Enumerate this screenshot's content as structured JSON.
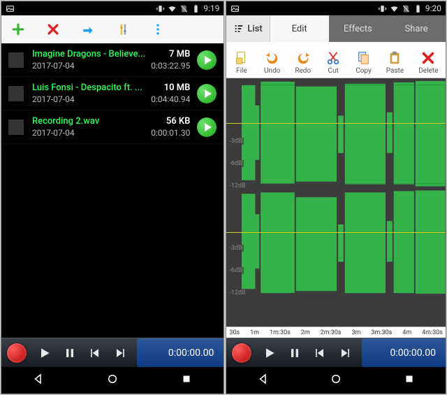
{
  "left": {
    "status": {
      "time": "9:19"
    },
    "files": [
      {
        "title": "Imagine Dragons - Believe...",
        "date": "2017-07-04",
        "size": "7 MB",
        "duration": "0:03:22.95"
      },
      {
        "title": "Luis Fonsi - Despacito ft. ...",
        "date": "2017-07-04",
        "size": "10 MB",
        "duration": "0:04:40.94"
      },
      {
        "title": "Recording 2.wav",
        "date": "2017-07-04",
        "size": "56 KB",
        "duration": "0:00:01.30"
      }
    ],
    "transport_time": "0:00:00.00"
  },
  "right": {
    "status": {
      "time": "9:20"
    },
    "list_button": "List",
    "tabs": {
      "edit": "Edit",
      "effects": "Effects",
      "share": "Share"
    },
    "tools": {
      "file": "File",
      "undo": "Undo",
      "redo": "Redo",
      "cut": "Cut",
      "copy": "Copy",
      "paste": "Paste",
      "delete": "Delete"
    },
    "db_labels": [
      "-3dB",
      "-6dB",
      "-12dB",
      "-3dB",
      "-6dB",
      "-12dB"
    ],
    "timeline": [
      "30s",
      "1m",
      "1m:30s",
      "2m",
      "2m:30s",
      "3m",
      "3m:30s",
      "4m",
      "4m:30s"
    ],
    "transport_time": "0:00:00.00"
  }
}
